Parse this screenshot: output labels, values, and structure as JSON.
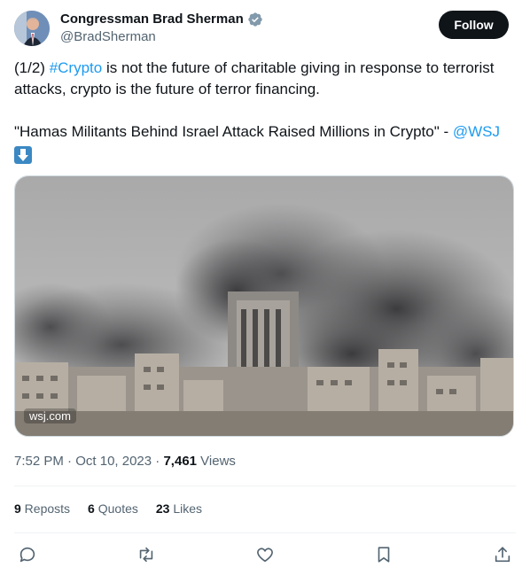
{
  "author": {
    "name": "Congressman Brad Sherman",
    "handle": "@BradSherman"
  },
  "follow_label": "Follow",
  "tweet": {
    "p1_prefix": "(1/2) ",
    "p1_hashtag": "#Crypto",
    "p1_rest": " is not the future of charitable giving in response to terrorist attacks, crypto is the future of terror financing.",
    "p2_text": "\"Hamas Militants Behind Israel Attack Raised Millions in Crypto\" - ",
    "p2_mention": "@WSJ"
  },
  "media": {
    "source": "wsj.com"
  },
  "meta": {
    "time": "7:52 PM",
    "sep1": " · ",
    "date": "Oct 10, 2023",
    "sep2": " · ",
    "views_count": "7,461",
    "views_label": " Views"
  },
  "stats": {
    "reposts_count": "9",
    "reposts_label": " Reposts",
    "quotes_count": "6",
    "quotes_label": " Quotes",
    "likes_count": "23",
    "likes_label": " Likes"
  },
  "icons": {
    "verified": "verified-badge-icon",
    "reply": "reply-icon",
    "repost": "repost-icon",
    "like": "heart-icon",
    "bookmark": "bookmark-icon",
    "share": "share-icon",
    "down_arrow": "down-arrow-emoji-icon"
  },
  "colors": {
    "link": "#1d9bf0",
    "follow_bg": "#0f1419",
    "muted": "#536471"
  }
}
